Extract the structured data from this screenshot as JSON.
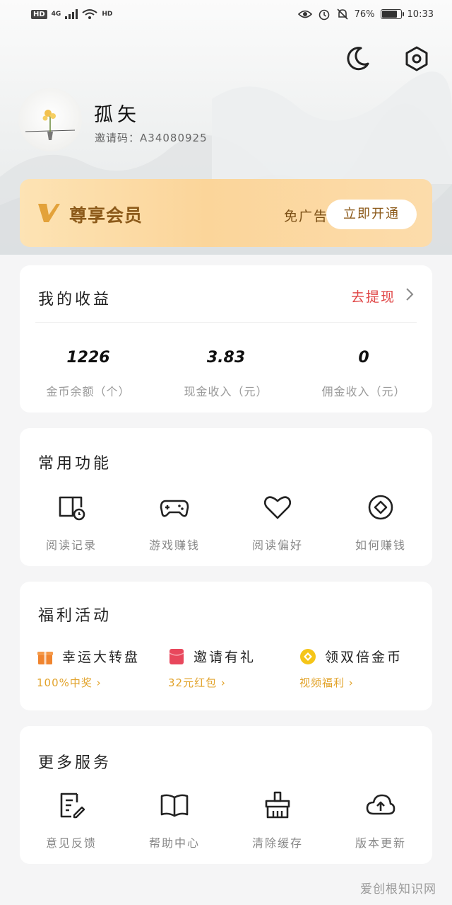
{
  "status_bar": {
    "hd": "HD",
    "network": "4G",
    "signal_label": "4G",
    "wifi_small": "HD",
    "battery": "76%",
    "battery_level": 0.76,
    "time": "10:33"
  },
  "profile": {
    "username": "孤矢",
    "invite_label": "邀请码",
    "invite_code": "A34080925"
  },
  "vip": {
    "title": "尊享会员",
    "ad_text": "免广告",
    "button": "立即开通"
  },
  "income": {
    "title": "我的收益",
    "withdraw": "去提现",
    "stats": [
      {
        "value": "1226",
        "label": "金币余额（个）"
      },
      {
        "value": "3.83",
        "label": "现金收入（元）"
      },
      {
        "value": "0",
        "label": "佣金收入（元）"
      }
    ]
  },
  "common_functions": {
    "title": "常用功能",
    "items": [
      {
        "label": "阅读记录",
        "icon": "book-clock-icon"
      },
      {
        "label": "游戏赚钱",
        "icon": "gamepad-icon"
      },
      {
        "label": "阅读偏好",
        "icon": "heart-icon"
      },
      {
        "label": "如何赚钱",
        "icon": "coin-icon"
      }
    ]
  },
  "welfare": {
    "title": "福利活动",
    "items": [
      {
        "name": "幸运大转盘",
        "sub": "100%中奖",
        "icon": "gift-icon",
        "color": "#f0842e"
      },
      {
        "name": "邀请有礼",
        "sub": "32元红包",
        "icon": "red-envelope-icon",
        "color": "#e8475c"
      },
      {
        "name": "领双倍金币",
        "sub": "视频福利",
        "icon": "gold-coin-icon",
        "color": "#f5c518"
      }
    ]
  },
  "more_services": {
    "title": "更多服务",
    "items": [
      {
        "label": "意见反馈",
        "icon": "feedback-icon"
      },
      {
        "label": "帮助中心",
        "icon": "help-book-icon"
      },
      {
        "label": "清除缓存",
        "icon": "clear-cache-icon"
      },
      {
        "label": "版本更新",
        "icon": "cloud-upload-icon"
      }
    ]
  },
  "watermark": "爱创根知识网",
  "colors": {
    "accent_red": "#e04545",
    "vip_gold": "#8c5a1a",
    "welfare_sub": "#e2a32b"
  }
}
